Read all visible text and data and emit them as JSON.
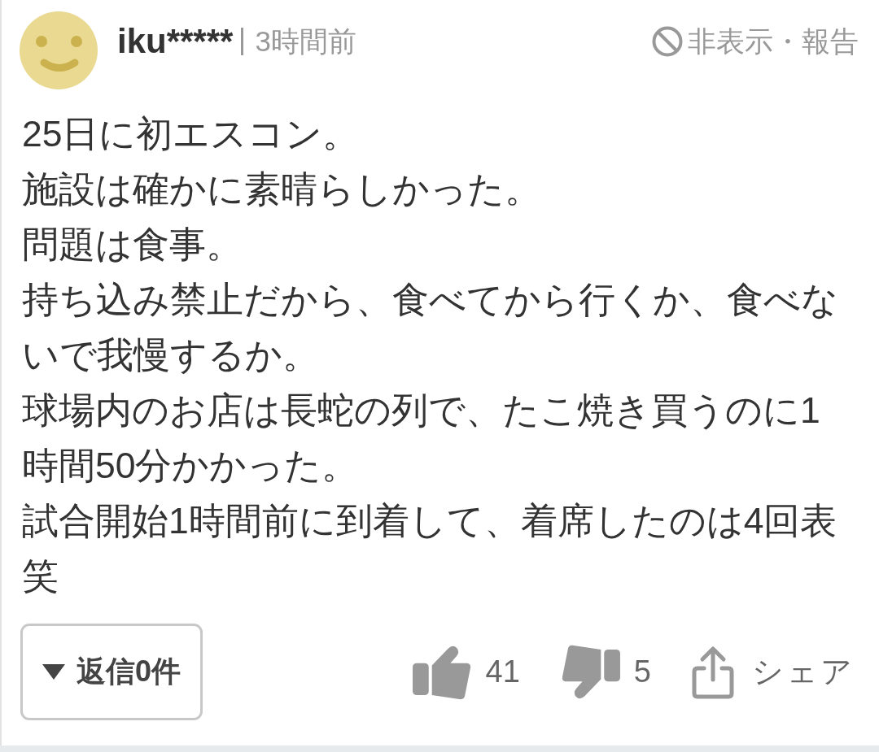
{
  "comment": {
    "username": "iku*****",
    "time": "3時間前",
    "hide_report": "非表示・報告",
    "paragraphs": [
      "25日に初エスコン。",
      "施設は確かに素晴らしかった。",
      "問題は食事。",
      "持ち込み禁止だから、食べてから行くか、食べないで我慢するか。",
      "球場内のお店は長蛇の列で、たこ焼き買うのに1時間50分かかった。",
      "試合開始1時間前に到着して、着席したのは4回表笑"
    ],
    "replies_button": {
      "label": "返信0件",
      "expanded": false
    },
    "reactions": [
      {
        "kind": "like",
        "count": "41"
      },
      {
        "kind": "dislike",
        "count": "5"
      }
    ],
    "share": {
      "label": "シェア"
    }
  }
}
